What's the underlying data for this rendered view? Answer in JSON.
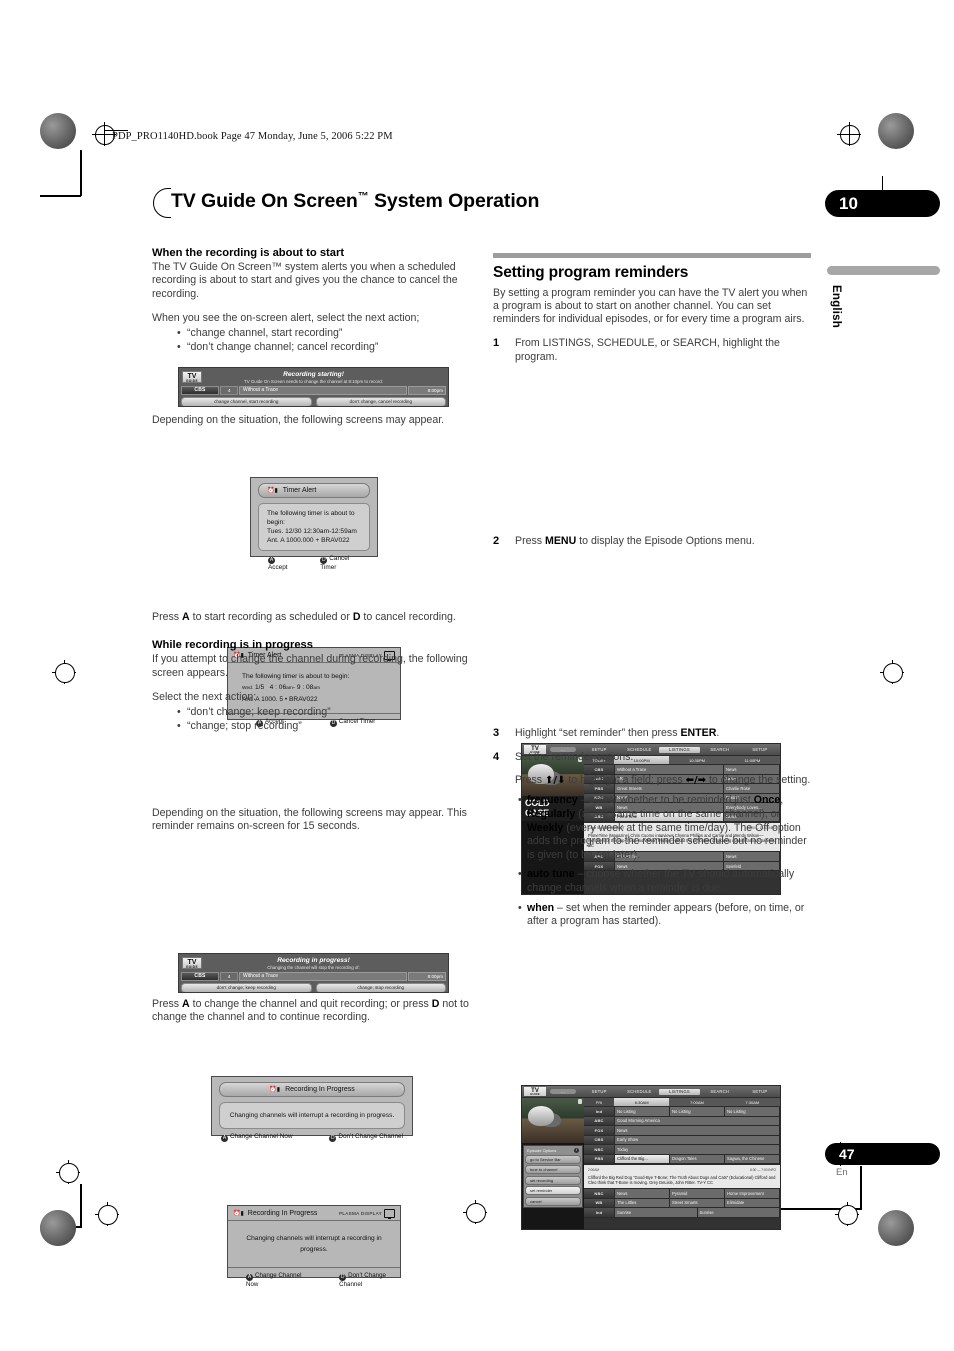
{
  "header": {
    "filestamp": "PDP_PRO1140HD.book  Page 47  Monday, June 5, 2006  5:22 PM",
    "chapter_title": "TV Guide On Screen",
    "chapter_title_tm": "™",
    "chapter_title_rest": " System Operation",
    "chapter_number": "10",
    "language": "English"
  },
  "footer": {
    "page_number": "47",
    "page_language": "En"
  },
  "left_column": {
    "heading1": "When the recording is about to start",
    "para1": "The TV Guide On Screen™ system alerts you when a scheduled recording is about to start and gives you the chance to cancel the recording.",
    "para2": "When you see the on-screen alert, select the next action;",
    "bullets1": [
      "“change channel, start recording”",
      "“don’t change channel; cancel recording”"
    ],
    "para3": "Depending on the situation, the following screens may appear.",
    "para4_a": "Press ",
    "para4_b": "A",
    "para4_c": " to start recording as scheduled or ",
    "para4_d": "D",
    "para4_e": " to cancel recording.",
    "heading2": "While recording is in progress",
    "para5": "If you attempt to change the channel during recording, the following screen appears.",
    "para6": "Select the next action:",
    "bullets2": [
      "“don’t change; keep recording”",
      "“change; stop recording”"
    ],
    "para7": "Depending on the situation, the following screens may appear. This reminder remains on-screen for 15 seconds.",
    "para8_a": "Press ",
    "para8_b": "A",
    "para8_c": " to change the channel and quit recording; or press ",
    "para8_d": "D",
    "para8_e": " not to change the channel and to continue recording."
  },
  "right_column": {
    "heading": "Setting program reminders",
    "intro": "By setting a program reminder you can have the TV alert you when a program is about to start on another channel. You can set reminders for individual episodes, or for every time a program airs.",
    "steps": [
      {
        "num": "1",
        "text": "From LISTINGS, SCHEDULE, or SEARCH, highlight the program."
      },
      {
        "num": "2",
        "text_a": "Press ",
        "text_b": "MENU",
        "text_c": " to display the Episode Options menu."
      },
      {
        "num": "3",
        "text_a": "Highlight “set reminder” then press ",
        "text_b": "ENTER",
        "text_c": "."
      },
      {
        "num": "4",
        "text": "Set the reminder options."
      }
    ],
    "step4_instruction_a": "Press ",
    "step4_arrow_ud": "⬆/⬇",
    "step4_instruction_b": " to highlight a field; press ",
    "step4_arrow_lr": "⬅/➡",
    "step4_instruction_c": " to change the setting.",
    "option_bullets": [
      {
        "term": "frequency",
        "parts": [
          {
            "text": " – select whether to be reminded just "
          },
          {
            "text": "Once",
            "bold": true
          },
          {
            "text": ", "
          },
          {
            "text": "Regularly",
            "bold": true
          },
          {
            "text": " (at the same time on the same channel), or "
          },
          {
            "text": "Weekly",
            "bold": true
          },
          {
            "text": " (every week at the same time/day). The Off option adds the program to the reminder schedule but no reminder is given (to be set later)."
          }
        ]
      },
      {
        "term": "auto tune",
        "parts": [
          {
            "text": " – choose whether the TV should automatically change channels when a reminder is due."
          }
        ]
      },
      {
        "term": "when",
        "parts": [
          {
            "text": " – set when the reminder appears (before, on time, or after a program has started)."
          }
        ]
      }
    ]
  },
  "figures": {
    "recording_starting_banner": {
      "logo": "TV",
      "logo_sub": "GUIDE",
      "title": "Recording starting!",
      "subtitle": "TV Guide On Screen needs to change the channel at  8:10pm to record:",
      "channel": "CBS",
      "channel_number": "4",
      "program": "Without a Trace",
      "time": "8:00pm",
      "button_left": "change channel, start recording",
      "button_right": "don’t change, cancel recording"
    },
    "timer_alert_a": {
      "title": "Timer  Alert",
      "line1": "The following timer is about to begin:",
      "line2": "Tues. 12/30 12:30am-12:59am",
      "line3": "Ant. A 1000.000 + BRAV022",
      "accept_key": "A",
      "accept_label": "Accept",
      "cancel_key": "D",
      "cancel_label": "Cancel Timer"
    },
    "timer_alert_b": {
      "title": "Timer  Alert",
      "plasma_label": "PLASMA DISPLAY",
      "line1": "The following timer is about to begin:",
      "line2_day": "Wed.",
      "line2_date": "1/5",
      "line2_start": "4 : 06",
      "line2_start_ampm": "am",
      "line2_dash": "-",
      "line2_end": "9 : 08",
      "line2_end_ampm": "am",
      "line3": "Ant. A   1000. 5   • BRAV022",
      "accept_key": "A",
      "accept_label": "Accept",
      "cancel_key": "D",
      "cancel_label": "Cancel Timer"
    },
    "recording_progress_banner": {
      "logo": "TV",
      "logo_sub": "GUIDE",
      "title": "Recording in progress!",
      "subtitle": "Changing the channel will stop the recording of:",
      "channel": "CBS",
      "channel_number": "4",
      "program": "Without a Trace",
      "time": "8:00pm",
      "button_left": "don’t change; keep recording",
      "button_right": "change; stop recording"
    },
    "recording_in_progress_a": {
      "title": "Recording In Progress",
      "body": "Changing channels will interrupt a recording in progress.",
      "accept_key": "A",
      "accept_label": "Change Channel Now",
      "cancel_key": "D",
      "cancel_label": "Don’t Change Channel"
    },
    "recording_in_progress_b": {
      "title": "Recording In Progress",
      "plasma_label": "PLASMA DISPLAY",
      "body": "Changing channels will interrupt a recording in progress.",
      "accept_key": "A",
      "accept_label": "Change Channel Now",
      "cancel_key": "D",
      "cancel_label": "Don’t Change Channel"
    },
    "listings_screen": {
      "logo": "TV",
      "logo_sub": "GUIDE",
      "menu": [
        "SETUP",
        "SCHEDULE",
        "LISTINGS",
        "SEARCH",
        "SETUP"
      ],
      "menu_selected": "LISTINGS",
      "menu_pill": "...",
      "video_title_1": "COLD",
      "video_title_2": "CASE",
      "day_label": "TODAY",
      "time_slots": [
        "10:00PM",
        "10:30PM",
        "11:00PM"
      ],
      "highlighted_slot": "10:00PM",
      "rows": [
        {
          "channel": "CBS",
          "cells": [
            "Without a Trace",
            "News"
          ]
        },
        {
          "channel": "ABC",
          "cells": [
            "ER",
            "News"
          ]
        },
        {
          "channel": "PBS",
          "cells": [
            "Great Streets",
            "Charlie Rose"
          ]
        },
        {
          "channel": "NBC",
          "cells": [
            "News",
            "Frasier"
          ]
        },
        {
          "channel": "WB",
          "cells": [
            "News",
            "Everybody Loves..."
          ]
        },
        {
          "channel": "ABC",
          "cells": [
            "PrimeTime",
            "News"
          ]
        }
      ],
      "detail_meta_left": "Cable Box 885 WCVB-DT",
      "detail_meta_right": "10:00 — 11:00  INFO",
      "detail_text": "PrimeTime (Magazine) Chris Cuomo interviews Chynna Phillips and Carnie and Wendy Wilson—members of the pop-music trio Wilson Phillips—about the difficulties of growing up with famous parents.  CC",
      "bottom_rows": [
        {
          "channel": "ABC",
          "cells": [
            "PrimeTime",
            "News"
          ]
        },
        {
          "channel": "FOX",
          "cells": [
            "News",
            "Seinfeld"
          ]
        }
      ]
    },
    "episode_options_screen": {
      "logo": "TV",
      "logo_sub": "GUIDE",
      "menu": [
        "SETUP",
        "SCHEDULE",
        "LISTINGS",
        "SEARCH",
        "SETUP"
      ],
      "menu_selected": "LISTINGS",
      "menu_pill": "...",
      "day_label": "FRI",
      "time_slots": [
        "6:30AM",
        "7:00AM",
        "7:30AM"
      ],
      "highlighted_slot": "6:30AM",
      "options_title": "Episode Options",
      "options": [
        "go to Service Bar",
        "tune to channel",
        "set recording",
        "set reminder",
        "cancel"
      ],
      "options_selected": "set reminder",
      "rows": [
        {
          "channel": "Ind",
          "cells": [
            "No Listing",
            "No Listing",
            "No Listing"
          ]
        },
        {
          "channel": "ABC",
          "cells": [
            "Good Morning America"
          ]
        },
        {
          "channel": "FOX",
          "cells": [
            "News"
          ]
        },
        {
          "channel": "CBS",
          "cells": [
            "Early Show"
          ]
        },
        {
          "channel": "NBC",
          "cells": [
            "Today"
          ]
        },
        {
          "channel": "PBS",
          "cells": [
            "Clifford the Big...",
            "Dragon Tales",
            "Sagwa, the Chinese"
          ]
        }
      ],
      "detail_meta_left": "2:00AM",
      "detail_meta_right": "6:30 — 7:00  INFO",
      "detail_text": "Clifford the Big Red Dog “Good-Bye T-Bone; The Truth About Dogs and Cats” (Educational) Clifford and Cleo think that T-Bone is moving. Grey DeLisle, John Ritter. TV-Y  CC",
      "bottom_rows": [
        {
          "channel": "NBC",
          "cells": [
            "News",
            "Pyramid",
            "Home Improvement"
          ]
        },
        {
          "channel": "WB",
          "cells": [
            "The Littles",
            "Street Smarts",
            "Elimidate"
          ]
        },
        {
          "channel": "Ind",
          "cells": [
            "Sunrise",
            "Sunrise"
          ]
        }
      ]
    }
  }
}
